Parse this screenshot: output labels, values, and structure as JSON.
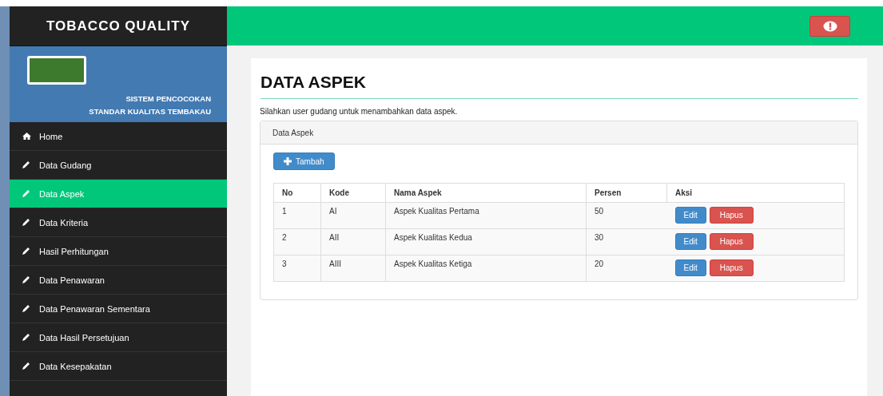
{
  "brand": "TOBACCO QUALITY",
  "profile": {
    "line_1": "SISTEM PENCOCOKAN",
    "line_2": "STANDAR KUALITAS TEMBAKAU"
  },
  "sidebar": {
    "items": [
      {
        "label": "Home",
        "kind": "home",
        "selected": false
      },
      {
        "label": "Data Gudang",
        "kind": "edit",
        "selected": false
      },
      {
        "label": "Data Aspek",
        "kind": "edit",
        "selected": true
      },
      {
        "label": "Data Kriteria",
        "kind": "edit",
        "selected": false
      },
      {
        "label": "Hasil Perhitungan",
        "kind": "edit",
        "selected": false
      },
      {
        "label": "Data Penawaran",
        "kind": "edit",
        "selected": false
      },
      {
        "label": "Data Penawaran Sementara",
        "kind": "edit",
        "selected": false
      },
      {
        "label": "Data Hasil Persetujuan",
        "kind": "edit",
        "selected": false
      },
      {
        "label": "Data Kesepakatan",
        "kind": "edit",
        "selected": false
      }
    ]
  },
  "page": {
    "title": "DATA ASPEK",
    "description": "Silahkan user gudang untuk menambahkan data aspek."
  },
  "panel": {
    "heading": "Data Aspek",
    "add_button": "Tambah"
  },
  "table": {
    "columns": [
      "No",
      "Kode",
      "Nama Aspek",
      "Persen",
      "Aksi"
    ],
    "rows": [
      {
        "no": "1",
        "kode": "AI",
        "nama": "Aspek Kualitas Pertama",
        "persen": "50",
        "edit": "Edit",
        "delete": "Hapus"
      },
      {
        "no": "2",
        "kode": "AII",
        "nama": "Aspek Kualitas Kedua",
        "persen": "30",
        "edit": "Edit",
        "delete": "Hapus"
      },
      {
        "no": "3",
        "kode": "AIII",
        "nama": "Aspek Kualitas Ketiga",
        "persen": "20",
        "edit": "Edit",
        "delete": "Hapus"
      }
    ]
  }
}
